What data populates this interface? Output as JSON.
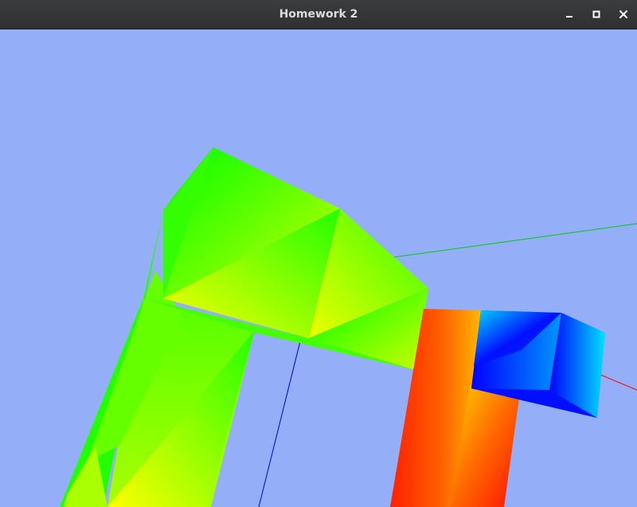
{
  "window": {
    "title": "Homework 2"
  },
  "controls": {
    "minimize_icon": "minimize-icon",
    "maximize_icon": "maximize-icon",
    "close_icon": "close-icon"
  },
  "viewport": {
    "background_color": "#94aff7",
    "axis_colors": {
      "x": "#ff0000",
      "y": "#00cc00",
      "z": "#0000cc"
    },
    "object_colors": {
      "green_arm": [
        "#00ff00",
        "#ccff00",
        "#ffff00"
      ],
      "red_column": [
        "#ff2000",
        "#ffcc00"
      ],
      "blue_cube": [
        "#0000ff",
        "#00e5ff"
      ]
    }
  }
}
